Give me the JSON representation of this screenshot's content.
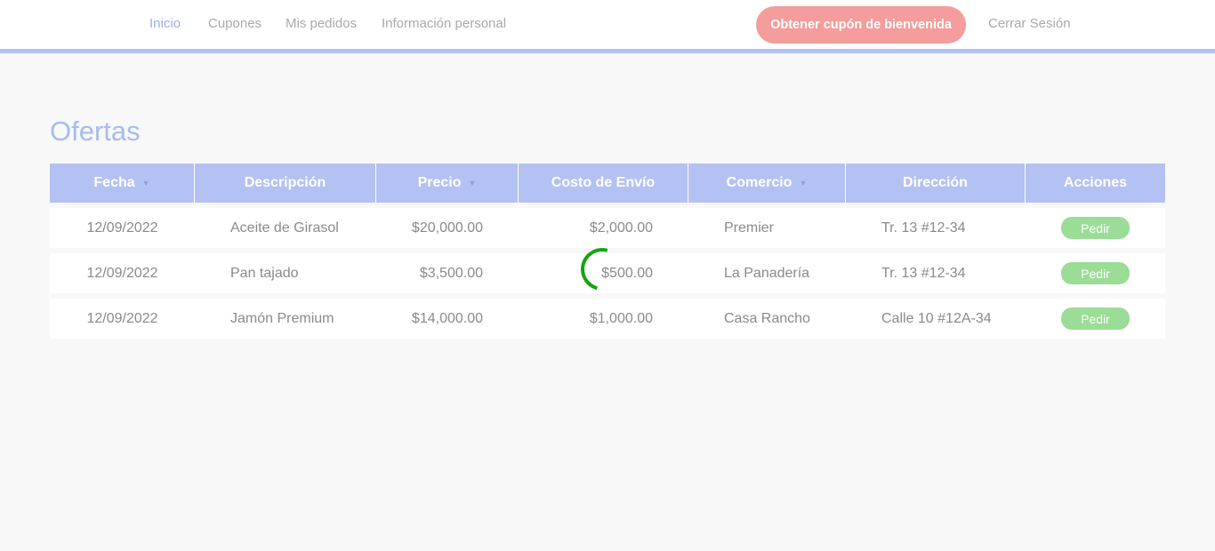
{
  "nav": {
    "items": [
      "Inicio",
      "Cupones",
      "Mis pedidos",
      "Información personal"
    ],
    "welcome_button": "Obtener cupón de bienvenida",
    "logout": "Cerrar Sesión"
  },
  "page": {
    "title": "Ofertas"
  },
  "table": {
    "headers": [
      "Fecha",
      "Descripción",
      "Precio",
      "Costo de Envío",
      "Comercio",
      "Dirección",
      "Acciones"
    ],
    "sortable": [
      "Fecha",
      "Precio",
      "Comercio"
    ],
    "rows": [
      [
        "12/09/2022",
        "Aceite de Girasol",
        "$20,000.00",
        "$2,000.00",
        "Premier",
        "Tr. 13 #12-34",
        "Pedir"
      ],
      [
        "12/09/2022",
        "Pan tajado",
        "$3,500.00",
        "$500.00",
        "La Panadería",
        "Tr. 13 #12-34",
        "Pedir"
      ],
      [
        "12/09/2022",
        "Jamón Premium",
        "$14,000.00",
        "$1,000.00",
        "Casa Rancho",
        "Calle 10 #12A-34",
        "Pedir"
      ]
    ]
  },
  "icons": {
    "sort": "caret-down-icon",
    "loading": "loading-spinner-icon"
  },
  "colors": {
    "accent": "#b3c2f2",
    "welcome_button": "#f59c9c",
    "action_button": "#9bdc96",
    "spinner": "#11a611"
  }
}
